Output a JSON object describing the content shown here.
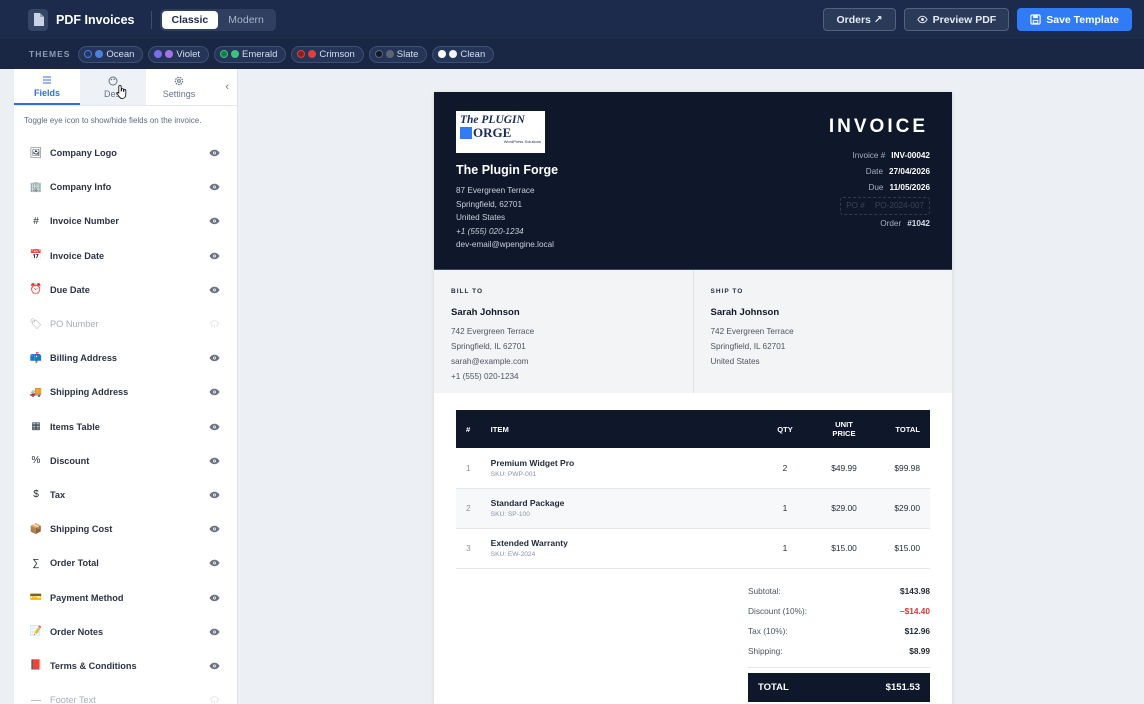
{
  "app": {
    "title": "PDF Invoices"
  },
  "mode": {
    "options": [
      "Classic",
      "Modern"
    ],
    "selected": "Classic"
  },
  "actions": {
    "orders": "Orders ↗",
    "preview": "Preview PDF",
    "save": "Save Template"
  },
  "themes": {
    "label": "THEMES",
    "items": [
      {
        "name": "Ocean",
        "c1": "#1e3a5f",
        "c2": "#4f7fd9"
      },
      {
        "name": "Violet",
        "c1": "#7c6ee8",
        "c2": "#a473e6"
      },
      {
        "name": "Emerald",
        "c1": "#157a4d",
        "c2": "#3cc47d"
      },
      {
        "name": "Crimson",
        "c1": "#8a1f1f",
        "c2": "#e0403d"
      },
      {
        "name": "Slate",
        "c1": "#1f2937",
        "c2": "#5b6473"
      },
      {
        "name": "Clean",
        "c1": "#ffffff",
        "c2": "#f1f5f9"
      }
    ]
  },
  "sidebar": {
    "tabs": {
      "fields": "Fields",
      "design": "Desi",
      "settings": "Settings"
    },
    "hint": "Toggle eye icon to show/hide fields on the invoice.",
    "fields": [
      {
        "label": "Company Logo",
        "icon": "🖼",
        "visible": true
      },
      {
        "label": "Company Info",
        "icon": "🏢",
        "visible": true
      },
      {
        "label": "Invoice Number",
        "icon": "#",
        "visible": true
      },
      {
        "label": "Invoice Date",
        "icon": "📅",
        "visible": true
      },
      {
        "label": "Due Date",
        "icon": "⏰",
        "visible": true
      },
      {
        "label": "PO Number",
        "icon": "🏷",
        "visible": false
      },
      {
        "label": "Billing Address",
        "icon": "📫",
        "visible": true
      },
      {
        "label": "Shipping Address",
        "icon": "🚚",
        "visible": true
      },
      {
        "label": "Items Table",
        "icon": "▦",
        "visible": true
      },
      {
        "label": "Discount",
        "icon": "%",
        "visible": true
      },
      {
        "label": "Tax",
        "icon": "$",
        "visible": true
      },
      {
        "label": "Shipping Cost",
        "icon": "📦",
        "visible": true
      },
      {
        "label": "Order Total",
        "icon": "∑",
        "visible": true
      },
      {
        "label": "Payment Method",
        "icon": "💳",
        "visible": true
      },
      {
        "label": "Order Notes",
        "icon": "📝",
        "visible": true
      },
      {
        "label": "Terms & Conditions",
        "icon": "📕",
        "visible": true
      },
      {
        "label": "Footer Text",
        "icon": "—",
        "visible": false
      }
    ]
  },
  "invoice": {
    "logo": {
      "line1": "The PLUGIN",
      "line2": "ORGE",
      "sub": "WordPress Solutions"
    },
    "company": {
      "name": "The Plugin Forge",
      "street": "87 Evergreen Terrace",
      "city": "Springfield, 62701",
      "country": "United States",
      "phone": "+1 (555) 020-1234",
      "email": "dev-email@wpengine.local"
    },
    "title": "INVOICE",
    "meta": {
      "number_label": "Invoice #",
      "number": "INV-00042",
      "date_label": "Date",
      "date": "27/04/2026",
      "due_label": "Due",
      "due": "11/05/2026",
      "po_label": "PO #",
      "po": "PO-2024-007",
      "order_label": "Order",
      "order": "#1042"
    },
    "bill_to": {
      "label": "BILL TO",
      "name": "Sarah Johnson",
      "lines": [
        "742 Evergreen Terrace",
        "Springfield, IL 62701",
        "sarah@example.com",
        "+1 (555) 020-1234"
      ]
    },
    "ship_to": {
      "label": "SHIP TO",
      "name": "Sarah Johnson",
      "lines": [
        "742 Evergreen Terrace",
        "Springfield, IL 62701",
        "United States"
      ]
    },
    "table": {
      "headers": {
        "num": "#",
        "item": "ITEM",
        "qty": "QTY",
        "unit": "UNIT PRICE",
        "total": "TOTAL"
      },
      "rows": [
        {
          "num": "1",
          "name": "Premium Widget Pro",
          "sku": "SKU: PWP-001",
          "qty": "2",
          "unit": "$49.99",
          "total": "$99.98"
        },
        {
          "num": "2",
          "name": "Standard Package",
          "sku": "SKU: SP-100",
          "qty": "1",
          "unit": "$29.00",
          "total": "$29.00"
        },
        {
          "num": "3",
          "name": "Extended Warranty",
          "sku": "SKU: EW-2024",
          "qty": "1",
          "unit": "$15.00",
          "total": "$15.00"
        }
      ]
    },
    "totals": {
      "subtotal_label": "Subtotal:",
      "subtotal": "$143.98",
      "discount_label": "Discount (10%):",
      "discount": "–$14.40",
      "tax_label": "Tax (10%):",
      "tax": "$12.96",
      "shipping_label": "Shipping:",
      "shipping": "$8.99",
      "total_label": "TOTAL",
      "total": "$151.53"
    }
  }
}
